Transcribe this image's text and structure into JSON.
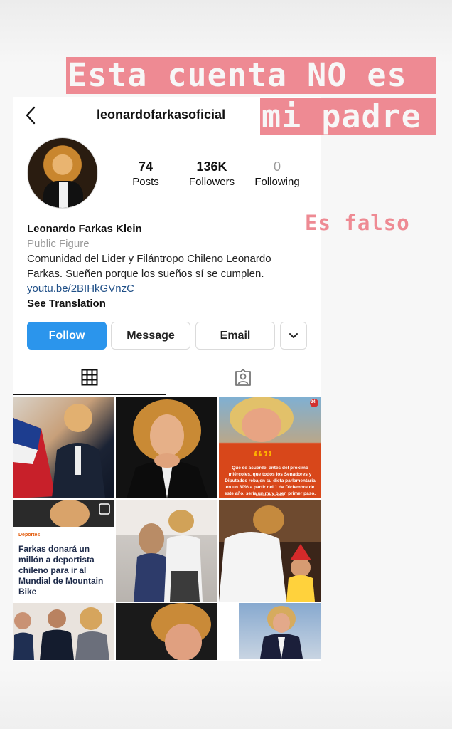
{
  "header": {
    "username": "leonardofarkasoficial"
  },
  "stats": [
    {
      "value": "74",
      "label": "Posts"
    },
    {
      "value": "136K",
      "label": "Followers"
    },
    {
      "value": "0",
      "label": "Following"
    }
  ],
  "bio": {
    "name": "Leonardo Farkas Klein",
    "category": "Public Figure",
    "description_line1": "Comunidad del Lider y Filántropo Chileno Leonardo",
    "description_line2": "Farkas. Sueñen porque los sueños sí se cumplen.",
    "link": "youtu.be/2BIHkGVnzC",
    "see_translation": "See Translation"
  },
  "buttons": {
    "follow": "Follow",
    "message": "Message",
    "email": "Email"
  },
  "posts": {
    "quote_text": "Que se acuerde, antes del próximo miércoles, que todos los Senadores y Diputados rebajen su dieta parlamentaria en un 30% a partir del 1 de Diciembre de este año, sería un muy buen primer paso, de los muchos que deberían venir.",
    "quote_author": "LEONARDO FARKAS",
    "quote_badge": "24",
    "news_tag": "Deportes",
    "news_title": "Farkas donará un millón a deportista chileno para ir al Mundial de Mountain Bike"
  },
  "overlay": {
    "line1": "Esta cuenta NO es",
    "line2": "mi padre",
    "small": "Es falso"
  },
  "colors": {
    "follow_blue": "#2b95ec",
    "overlay_pink": "#ee8a93",
    "link_blue": "#1f4f87"
  }
}
